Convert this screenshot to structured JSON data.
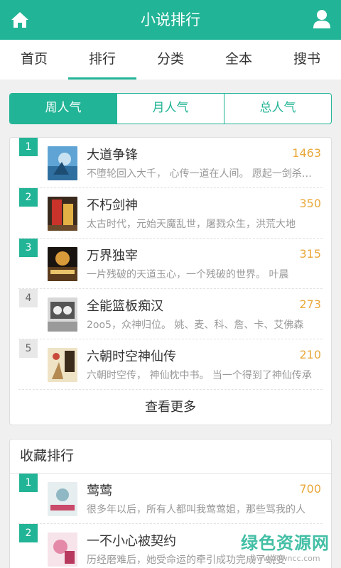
{
  "appbar": {
    "title": "小说排行",
    "home_icon": "home-icon",
    "user_icon": "user-icon"
  },
  "nav": {
    "tabs": [
      {
        "label": "首页",
        "active": false
      },
      {
        "label": "排行",
        "active": true
      },
      {
        "label": "分类",
        "active": false
      },
      {
        "label": "全本",
        "active": false
      },
      {
        "label": "搜书",
        "active": false
      }
    ]
  },
  "segments": [
    {
      "label": "周人气",
      "active": true
    },
    {
      "label": "月人气",
      "active": false
    },
    {
      "label": "总人气",
      "active": false
    }
  ],
  "popular": {
    "items": [
      {
        "rank": "1",
        "title": "大道争锋",
        "count": "1463",
        "desc": "不堕轮回入大千， 心传一道在人间。 愿起一剑杀万劫"
      },
      {
        "rank": "2",
        "title": "不朽剑神",
        "count": "350",
        "desc": "太古时代，元始天魔乱世，屠戮众生，洪荒大地"
      },
      {
        "rank": "3",
        "title": "万界独宰",
        "count": "315",
        "desc": "一片残破的天道玉心，一个残破的世界。 叶晨"
      },
      {
        "rank": "4",
        "title": "全能篮板痴汉",
        "count": "273",
        "desc": "2oo5，众神归位。 姚、麦、科、詹、卡、艾佛森"
      },
      {
        "rank": "5",
        "title": "六朝时空神仙传",
        "count": "210",
        "desc": "六朝时空传， 神仙枕中书。 当一个得到了神仙传承"
      }
    ],
    "more_label": "查看更多"
  },
  "favorites": {
    "title": "收藏排行",
    "items": [
      {
        "rank": "1",
        "title": "莺莺",
        "count": "700",
        "desc": "很多年以后，所有人都叫我莺莺姐，那些骂我的人"
      },
      {
        "rank": "2",
        "title": "一不小心被契约",
        "count": "",
        "desc": "历经磨难后，她受命运的牵引成功完成了蜕变"
      }
    ]
  },
  "watermark": {
    "main": "绿色资源网",
    "sub": "www.downcc.com"
  },
  "colors": {
    "accent": "#22b496",
    "count": "#e9a83a"
  }
}
